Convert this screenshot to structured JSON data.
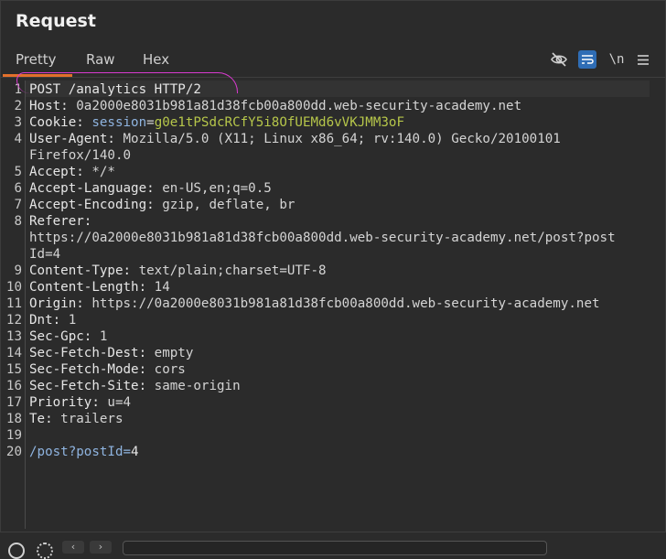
{
  "header": {
    "title": "Request"
  },
  "tabs": [
    "Pretty",
    "Raw",
    "Hex"
  ],
  "toolbar": {
    "hide_icon": "eye-slash-icon",
    "wrap_icon": "wrap-lines-icon",
    "newline_label": "\\n",
    "menu_icon": "hamburger-menu-icon"
  },
  "lines": [
    {
      "n": "1",
      "parts": [
        [
          "key",
          "POST /analytics HTTP/2"
        ]
      ]
    },
    {
      "n": "2",
      "parts": [
        [
          "key",
          "Host: "
        ],
        [
          "val",
          "0a2000e8031b981a81d38fcb00a800dd.web-security-academy.net"
        ]
      ]
    },
    {
      "n": "3",
      "parts": [
        [
          "key",
          "Cookie: "
        ],
        [
          "cookie-name",
          "session"
        ],
        [
          "val",
          "="
        ],
        [
          "cookie-val",
          "g0e1tPSdcRCfY5i8OfUEMd6vVKJMM3oF"
        ]
      ]
    },
    {
      "n": "4",
      "parts": [
        [
          "key",
          "User-Agent: "
        ],
        [
          "val",
          "Mozilla/5.0 (X11; Linux x86_64; rv:140.0) Gecko/20100101"
        ]
      ]
    },
    {
      "n": "",
      "parts": [
        [
          "val",
          "Firefox/140.0"
        ]
      ]
    },
    {
      "n": "5",
      "parts": [
        [
          "key",
          "Accept: "
        ],
        [
          "val",
          "*/*"
        ]
      ]
    },
    {
      "n": "6",
      "parts": [
        [
          "key",
          "Accept-Language: "
        ],
        [
          "val",
          "en-US,en;q=0.5"
        ]
      ]
    },
    {
      "n": "7",
      "parts": [
        [
          "key",
          "Accept-Encoding: "
        ],
        [
          "val",
          "gzip, deflate, br"
        ]
      ]
    },
    {
      "n": "8",
      "parts": [
        [
          "key",
          "Referer: "
        ]
      ]
    },
    {
      "n": "",
      "parts": [
        [
          "val",
          "https://0a2000e8031b981a81d38fcb00a800dd.web-security-academy.net/post?post"
        ]
      ]
    },
    {
      "n": "",
      "parts": [
        [
          "val",
          "Id=4"
        ]
      ]
    },
    {
      "n": "9",
      "parts": [
        [
          "key",
          "Content-Type: "
        ],
        [
          "val",
          "text/plain;charset=UTF-8"
        ]
      ]
    },
    {
      "n": "10",
      "parts": [
        [
          "key",
          "Content-Length: "
        ],
        [
          "val",
          "14"
        ]
      ]
    },
    {
      "n": "11",
      "parts": [
        [
          "key",
          "Origin: "
        ],
        [
          "val",
          "https://0a2000e8031b981a81d38fcb00a800dd.web-security-academy.net"
        ]
      ]
    },
    {
      "n": "12",
      "parts": [
        [
          "key",
          "Dnt: "
        ],
        [
          "val",
          "1"
        ]
      ]
    },
    {
      "n": "13",
      "parts": [
        [
          "key",
          "Sec-Gpc: "
        ],
        [
          "val",
          "1"
        ]
      ]
    },
    {
      "n": "14",
      "parts": [
        [
          "key",
          "Sec-Fetch-Dest: "
        ],
        [
          "val",
          "empty"
        ]
      ]
    },
    {
      "n": "15",
      "parts": [
        [
          "key",
          "Sec-Fetch-Mode: "
        ],
        [
          "val",
          "cors"
        ]
      ]
    },
    {
      "n": "16",
      "parts": [
        [
          "key",
          "Sec-Fetch-Site: "
        ],
        [
          "val",
          "same-origin"
        ]
      ]
    },
    {
      "n": "17",
      "parts": [
        [
          "key",
          "Priority: "
        ],
        [
          "val",
          "u=4"
        ]
      ]
    },
    {
      "n": "18",
      "parts": [
        [
          "key",
          "Te: "
        ],
        [
          "val",
          "trailers"
        ]
      ]
    },
    {
      "n": "19",
      "parts": []
    },
    {
      "n": "20",
      "parts": [
        [
          "path",
          "/post?postId="
        ],
        [
          "num",
          "4"
        ]
      ]
    }
  ],
  "colors": {
    "accent_tab": "#e2702b",
    "wrap_button": "#2f6db5",
    "annotation": "#d93ad0",
    "cookie_value": "#b6c64a",
    "cookie_name": "#8fb4e0"
  }
}
